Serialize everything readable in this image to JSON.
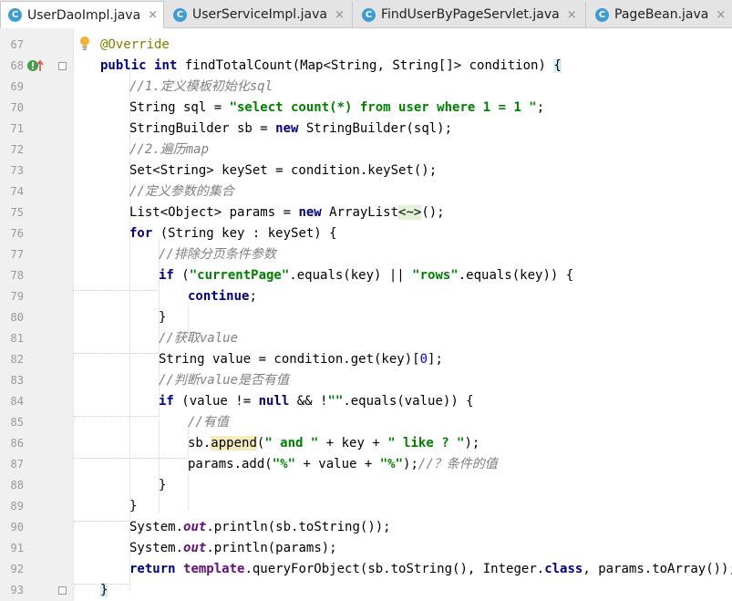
{
  "tabs": [
    {
      "label": "UserDaoImpl.java",
      "icon": "java-class-icon",
      "active": true
    },
    {
      "label": "UserServiceImpl.java",
      "icon": "java-class-icon",
      "active": false
    },
    {
      "label": "FindUserByPageServlet.java",
      "icon": "java-class-icon",
      "active": false
    },
    {
      "label": "PageBean.java",
      "icon": "java-class-icon",
      "active": false
    }
  ],
  "tab_icon_letter": "C",
  "tab_close_glyph": "×",
  "editor": {
    "line_numbers": [
      "67",
      "68",
      "69",
      "70",
      "71",
      "72",
      "73",
      "74",
      "75",
      "76",
      "77",
      "78",
      "79",
      "80",
      "81",
      "82",
      "83",
      "84",
      "85",
      "86",
      "87",
      "88",
      "89",
      "90",
      "91",
      "92",
      "93"
    ],
    "lines": [
      "@Override",
      "public int findTotalCount(Map<String, String[]> condition) {",
      "//1.定义模板初始化sql",
      "String sql = \"select count(*) from user where 1 = 1 \";",
      "StringBuilder sb = new StringBuilder(sql);",
      "//2.遍历map",
      "Set<String> keySet = condition.keySet();",
      "//定义参数的集合",
      "List<Object> params = new ArrayList<~>();",
      "for (String key : keySet) {",
      "//排除分页条件参数",
      "if (\"currentPage\".equals(key) || \"rows\".equals(key)) {",
      "continue;",
      "}",
      "//获取value",
      "String value = condition.get(key)[0];",
      "//判断value是否有值",
      "if (value != null && !\"\".equals(value)) {",
      "//有值",
      "sb.append(\" and \" + key + \" like ? \");",
      "params.add(\"%\" + value + \"%\");//？条件的值",
      "}",
      "}",
      "System.out.println(sb.toString());",
      "System.out.println(params);",
      "return template.queryForObject(sb.toString(), Integer.class, params.toArray());",
      "}"
    ]
  },
  "colors": {
    "keyword": "#000080",
    "string": "#008000",
    "comment": "#808080",
    "annotation": "#808000",
    "static_field": "#660e7a",
    "number": "#0000ff"
  }
}
